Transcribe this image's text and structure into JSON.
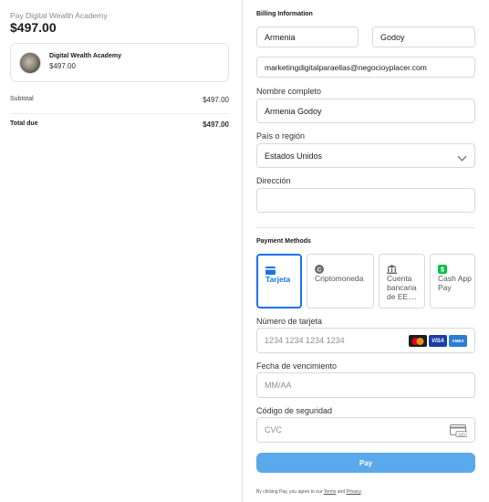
{
  "summary": {
    "pay_label": "Pay Digital Wealth Academy",
    "total": "$497.00",
    "product": {
      "name": "Digital Wealth Academy",
      "price": "$497.00"
    },
    "subtotal_label": "Subtotal",
    "subtotal_value": "$497.00",
    "total_due_label": "Total due",
    "total_due_value": "$497.00"
  },
  "billing": {
    "title": "Billing Information",
    "first_name": "Armenia",
    "last_name": "Godoy",
    "email": "marketingdigitalparaellas@negocioyplacer.com",
    "full_name_label": "Nombre completo",
    "full_name": "Armenia Godoy",
    "country_label": "País o región",
    "country": "Estados Unidos",
    "address_label": "Dirección",
    "address": ""
  },
  "payment": {
    "title": "Payment Methods",
    "methods": [
      {
        "label": "Tarjeta",
        "icon": "card-icon",
        "active": true
      },
      {
        "label": "Criptomoneda",
        "icon": "crypto-icon",
        "active": false
      },
      {
        "label": "Cuenta bancaria de EE....",
        "icon": "bank-icon",
        "active": false
      },
      {
        "label": "Cash App Pay",
        "icon": "cashapp-icon",
        "active": false
      }
    ],
    "card_number_label": "Número de tarjeta",
    "card_number_placeholder": "1234 1234 1234 1234",
    "brands": [
      "mastercard",
      "VISA",
      "AMEX"
    ],
    "expiry_label": "Fecha de vencimiento",
    "expiry_placeholder": "MM/AA",
    "cvc_label": "Código de seguridad",
    "cvc_placeholder": "CVC",
    "cvc_icon_text": "123"
  },
  "pay_button": "Pay",
  "footer": {
    "prefix": "By clicking Pay, you agree to our",
    "terms": "Terms",
    "and": "and",
    "privacy": "Privacy",
    "suffix": "."
  },
  "colors": {
    "accent": "#1a73e8",
    "pay_button": "#5aa9ea",
    "cashapp": "#00c244"
  }
}
